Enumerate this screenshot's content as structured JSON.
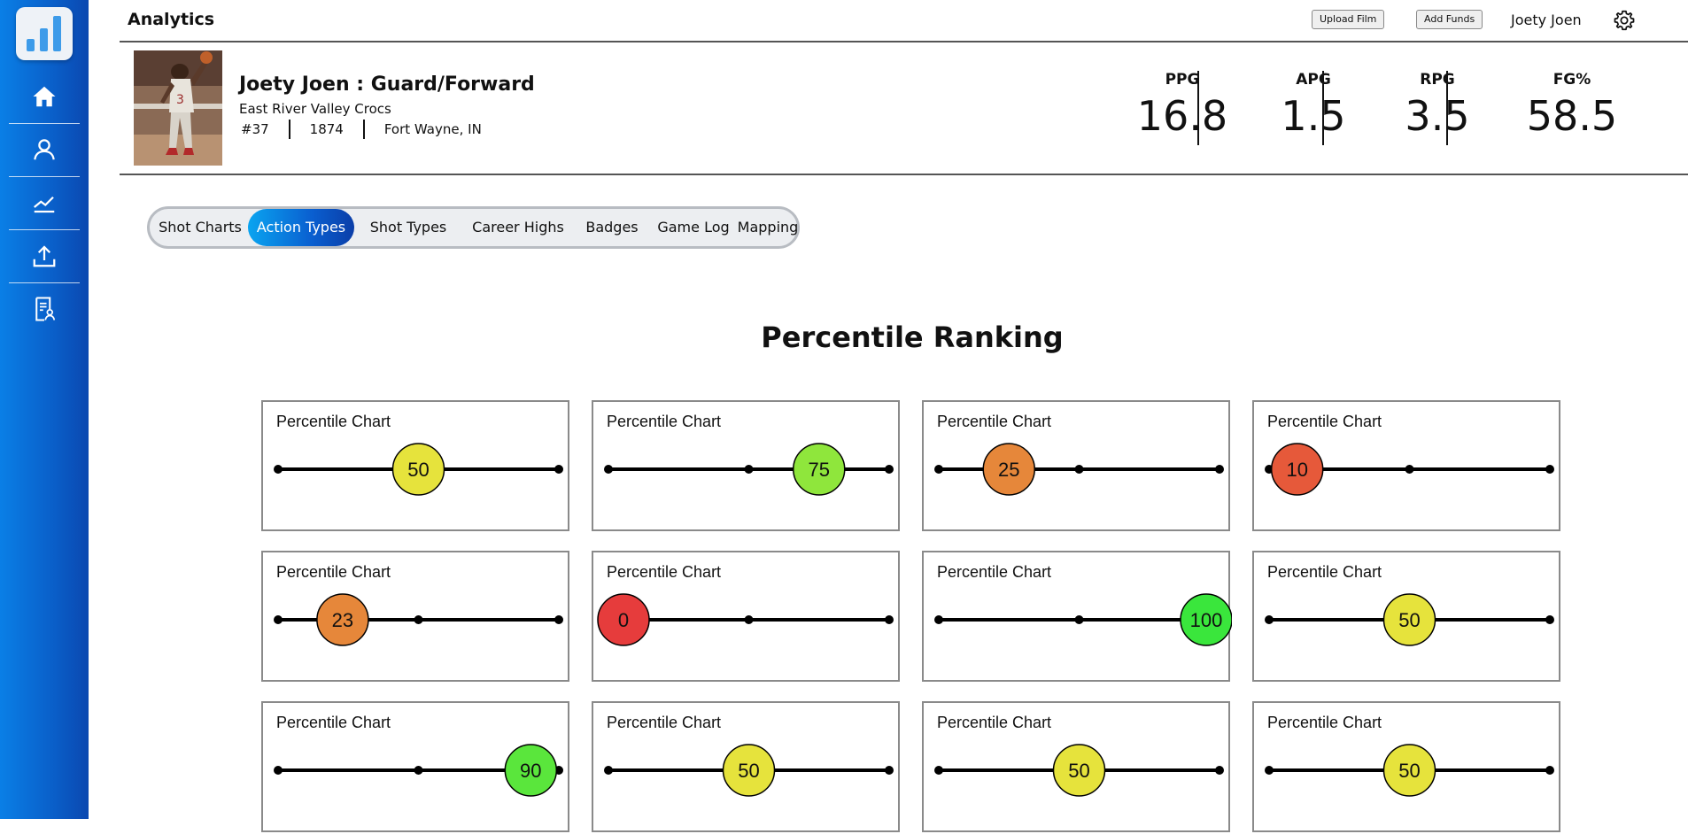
{
  "app": {
    "title": "Analytics"
  },
  "sidebar": {
    "items": [
      {
        "name": "home",
        "icon": "home-icon"
      },
      {
        "name": "profile",
        "icon": "user-icon"
      },
      {
        "name": "analytics",
        "icon": "line-chart-icon"
      },
      {
        "name": "upload",
        "icon": "upload-icon"
      },
      {
        "name": "reports",
        "icon": "report-icon"
      }
    ]
  },
  "header": {
    "upload_label": "Upload Film",
    "funds_label": "Add Funds",
    "username": "Joety Joen"
  },
  "player": {
    "name": "Joety Joen : Guard/Forward",
    "team": "East River Valley Crocs",
    "number": "#37",
    "id": "1874",
    "location": "Fort Wayne, IN",
    "stats": [
      {
        "label": "PPG",
        "value": "16.8"
      },
      {
        "label": "APG",
        "value": "1.5"
      },
      {
        "label": "RPG",
        "value": "3.5"
      },
      {
        "label": "FG%",
        "value": "58.5"
      }
    ]
  },
  "tabs": [
    {
      "label": "Shot Charts",
      "active": false
    },
    {
      "label": "Action Types",
      "active": true
    },
    {
      "label": "Shot Types",
      "active": false
    },
    {
      "label": "Career Highs",
      "active": false
    },
    {
      "label": "Badges",
      "active": false
    },
    {
      "label": "Game Log",
      "active": false
    },
    {
      "label": "Mapping",
      "active": false
    }
  ],
  "percentile": {
    "title": "Percentile Ranking",
    "card_title": "Percentile Chart",
    "colors": {
      "red": "#e63c3c",
      "red_orange": "#e6593a",
      "orange": "#e6873a",
      "yellow": "#e6e33c",
      "light_green": "#8fe63c",
      "green": "#5ae63c",
      "bright_green": "#3ae63c"
    },
    "charts": [
      {
        "value": 50,
        "color": "#e6e33c",
        "midpoint": false
      },
      {
        "value": 75,
        "color": "#8fe63c",
        "midpoint": true
      },
      {
        "value": 25,
        "color": "#e6873a",
        "midpoint": true
      },
      {
        "value": 10,
        "color": "#e6593a",
        "midpoint": true
      },
      {
        "value": 23,
        "color": "#e6873a",
        "midpoint": true
      },
      {
        "value": 0,
        "color": "#e63c3c",
        "midpoint": true
      },
      {
        "value": 100,
        "color": "#3ae63c",
        "midpoint": true
      },
      {
        "value": 50,
        "color": "#e6e33c",
        "midpoint": false
      },
      {
        "value": 90,
        "color": "#5ae63c",
        "midpoint": true
      },
      {
        "value": 50,
        "color": "#e6e33c",
        "midpoint": false
      },
      {
        "value": 50,
        "color": "#e6e33c",
        "midpoint": false
      },
      {
        "value": 50,
        "color": "#e6e33c",
        "midpoint": false
      }
    ]
  }
}
